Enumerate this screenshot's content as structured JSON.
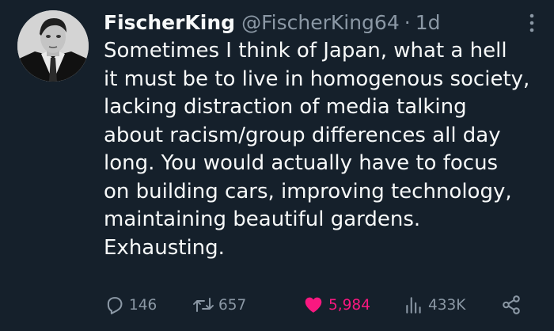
{
  "tweet": {
    "author": {
      "display_name": "FischerKing",
      "handle": "@FischerKing64",
      "separator": "·",
      "time": "1d"
    },
    "body_lines": [
      "Sometimes I think of Japan, what a hell",
      "it must be to live in homogenous society,",
      "lacking distraction of media talking",
      "about racism/group differences all day",
      "long. You would actually have to focus",
      "on building cars, improving technology,",
      "maintaining beautiful gardens.",
      "Exhausting."
    ],
    "actions": {
      "replies": "146",
      "retweets": "657",
      "likes": "5,984",
      "views": "433K"
    },
    "icons": {
      "avatar": "profile-photo",
      "more": "more-options-icon",
      "reply": "reply-icon",
      "retweet": "retweet-icon",
      "like": "heart-icon",
      "views": "views-chart-icon",
      "share": "share-icon"
    }
  },
  "colors": {
    "background": "#15202b",
    "text_primary": "#f7f9f9",
    "text_secondary": "#8b98a5",
    "like_active": "#f91880"
  }
}
